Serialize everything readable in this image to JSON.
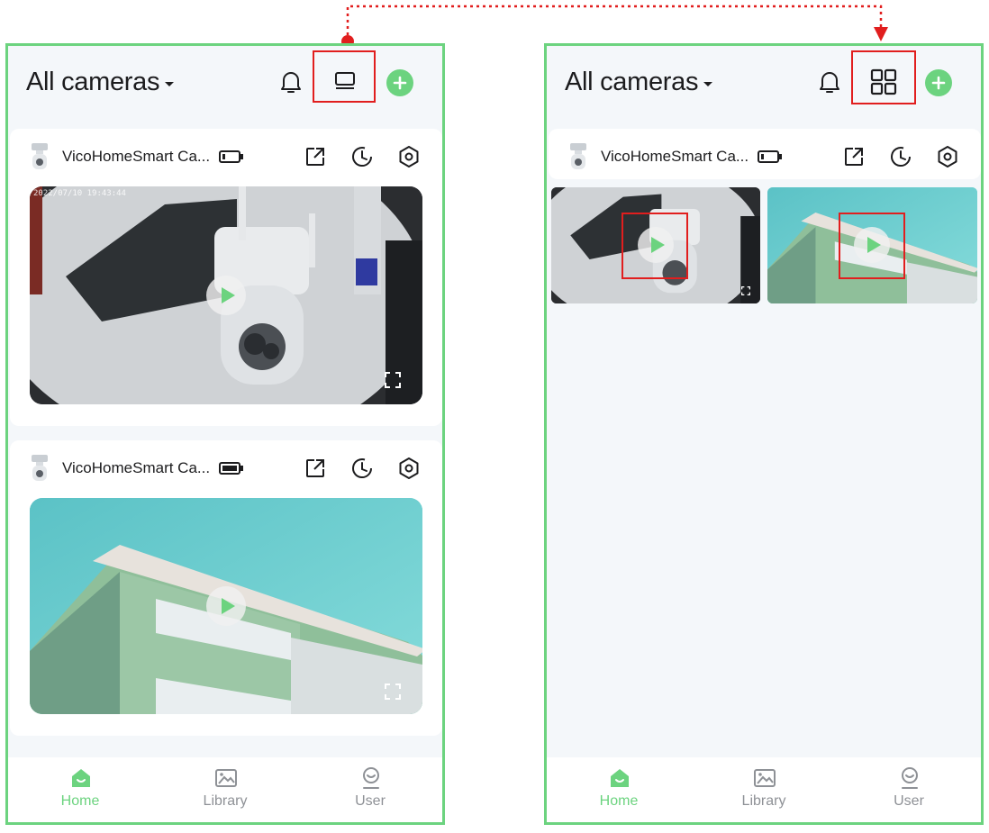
{
  "header": {
    "title": "All cameras"
  },
  "cameras": [
    {
      "name": "VicoHomeSmart Ca...",
      "timestamp": "2022/07/10 19:43:44"
    },
    {
      "name": "VicoHomeSmart Ca..."
    }
  ],
  "tabs": [
    {
      "label": "Home",
      "icon": "home-icon",
      "active": true
    },
    {
      "label": "Library",
      "icon": "image-icon",
      "active": false
    },
    {
      "label": "User",
      "icon": "user-icon",
      "active": false
    }
  ],
  "colors": {
    "accent": "#6cd37f",
    "frame": "#6cd37f",
    "highlight": "#e11e1e",
    "background": "#f4f7fa"
  }
}
